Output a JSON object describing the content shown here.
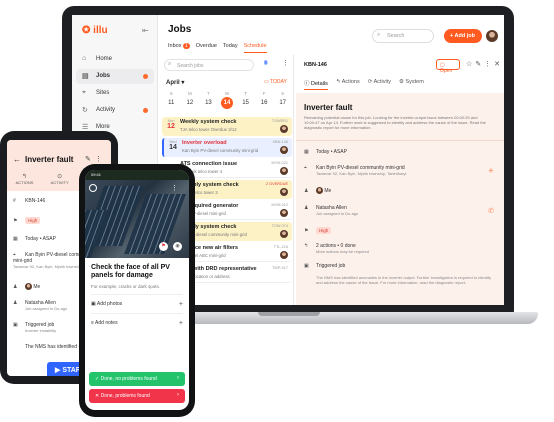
{
  "laptop": {
    "logo": "illu",
    "header": {
      "title": "Jobs",
      "tabs": [
        "Inbox",
        "Overdue",
        "Today",
        "Schedule"
      ],
      "inbox_count": "1",
      "selected_tab": "Schedule",
      "search_placeholder": "Search",
      "add_job": "+ Add job"
    },
    "sidebar": {
      "items": [
        {
          "icon": "home-icon",
          "label": "Home"
        },
        {
          "icon": "jobs-icon",
          "label": "Jobs",
          "active": true
        },
        {
          "icon": "sites-icon",
          "label": "Sites"
        },
        {
          "icon": "activity-icon",
          "label": "Activity"
        },
        {
          "icon": "more-icon",
          "label": "More"
        }
      ]
    },
    "list": {
      "search_placeholder": "Search jobs",
      "month": "April ▾",
      "today": "TODAY",
      "week": [
        {
          "d": "S",
          "n": "11"
        },
        {
          "d": "M",
          "n": "12"
        },
        {
          "d": "T",
          "n": "13"
        },
        {
          "d": "W",
          "n": "14",
          "sel": true
        },
        {
          "d": "T",
          "n": "15"
        },
        {
          "d": "F",
          "n": "16"
        },
        {
          "d": "S",
          "n": "17"
        }
      ],
      "cards": [
        {
          "wk": "Mon",
          "day": "12",
          "title": "Weekly system check",
          "sub": "TJA telco tower Overdue 3/12",
          "tag": "TOWER1",
          "style": "yellow"
        },
        {
          "wk": "Wed",
          "day": "14",
          "title": "Inverter overload",
          "sub": "Kan Byin PV-diesel community mini-grid",
          "tag": "KBN-146",
          "style": "sel"
        },
        {
          "wk": "",
          "day": "",
          "title": "ATS connection issue",
          "sub": "W-Myeik telco tower 4",
          "tag": "MYM-021",
          "style": "white"
        },
        {
          "wk": "",
          "day": "",
          "title": "Monthly system check",
          "sub": "Yaung telco tower 3",
          "tag": "2 OVERDUE",
          "style": "yellow"
        },
        {
          "wk": "",
          "day": "",
          "title": "Fix required generator",
          "sub": "NYK PV-diesel mini-grid",
          "tag": "MYM-012",
          "style": "white"
        },
        {
          "wk": "",
          "day": "",
          "title": "Weekly system check",
          "sub": "TNJ PV-diesel community mini-grid",
          "tag": "TOW-074",
          "style": "yellow"
        },
        {
          "wk": "",
          "day": "",
          "title": "Replace new air filters",
          "sub": "PV-diesel ABC mini-grid",
          "tag": "TTL-216",
          "style": "white"
        },
        {
          "wk": "",
          "day": "",
          "title": "Visit with DRD representative",
          "sub": "Saved location or address",
          "tag": "TWP-017",
          "style": "white"
        }
      ]
    },
    "detail": {
      "job_id": "KBN-146",
      "open_label": "Open",
      "tabs": [
        "Details",
        "Actions",
        "Activity",
        "System"
      ],
      "title": "Inverter fault",
      "description": "Remaining potential cause for this job. Looking for the inverter-output issue between 00:00:29 and 10:00:47 on Apr 14. Further work is suggested to identify and address the cause of the issue. Read the diagnostic report for more information.",
      "due": "Today • ASAP",
      "site": "Kan Byin PV-diesel community mini-grid",
      "site_sub": "Tadarvar 92, Kan Byin, Myeik township, Tanintharyi",
      "assignee": "Me",
      "contact": "Natasha Allen",
      "contact_sub": "Job assigned to Do-ago",
      "priority": "High",
      "actions": "2 actions • 0 done",
      "actions_sub": "More actions may be required",
      "trigger": "Triggered job",
      "trigger_text": "The NMS has identified anomalies in the inverter output. Further investigation is required to identify and address the cause of the issue. For more information, read the diagnostic report."
    }
  },
  "phone_left": {
    "title": "Inverter fault",
    "tabs": [
      "ACTIONS",
      "ACTIVITY",
      "SYSTEM"
    ],
    "job_id": "KBN-146",
    "priority": "High",
    "due": "Today • ASAP",
    "site": "Kan Byin PV-diesel community mini-grid",
    "site_sub": "Tadarvar 92, Kan Byin, Myeik township, Tanintharyi",
    "assignee": "Me",
    "contact": "Natasha Allen",
    "contact_sub": "Job assigned to Do-ago",
    "trigger": "Triggered job",
    "trigger_sub": "Inverter instability",
    "footnote": "The NMS has identified",
    "start": "START"
  },
  "phone_front": {
    "status": "09:41",
    "title": "Check the face of all PV panels for damage",
    "subtitle": "For example, cracks or dark spots.",
    "add_photos": "Add photos",
    "add_notes": "Add notes",
    "ok": "Done, no problems found",
    "bad": "Done, problems found"
  },
  "colors": {
    "accent": "#ff5a1f",
    "ok": "#22c36b",
    "bad": "#f2344a",
    "blue": "#2f64ff"
  }
}
